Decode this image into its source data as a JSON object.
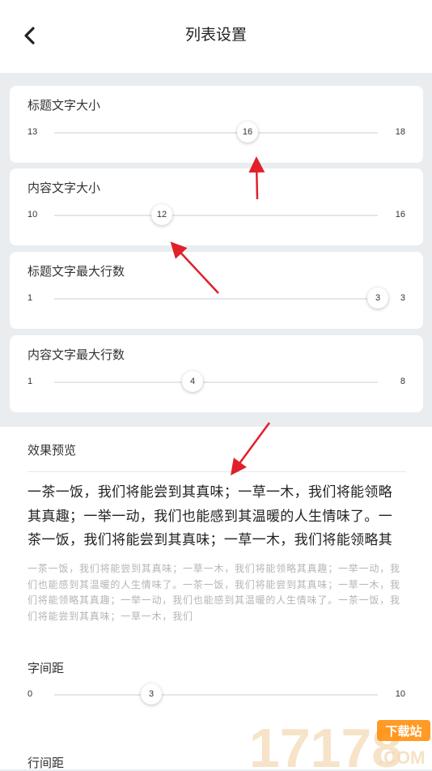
{
  "header": {
    "title": "列表设置"
  },
  "cards": [
    {
      "label": "标题文字大小",
      "min": "13",
      "max": "18",
      "value": "16",
      "ratio": 0.6
    },
    {
      "label": "内容文字大小",
      "min": "10",
      "max": "16",
      "value": "12",
      "ratio": 0.333
    },
    {
      "label": "标题文字最大行数",
      "min": "1",
      "max": "3",
      "value": "3",
      "ratio": 1.0
    },
    {
      "label": "内容文字最大行数",
      "min": "1",
      "max": "8",
      "value": "4",
      "ratio": 0.428
    }
  ],
  "preview": {
    "title": "效果预览",
    "main_text": "一茶一饭，我们将能尝到其真味；一草一木，我们将能领略其真趣；一举一动，我们也能感到其温暖的人生情味了。一茶一饭，我们将能尝到其真味；一草一木，我们将能领略其",
    "sub_text": "一茶一饭，我们将能尝到其真味；一草一木，我们将能领略其真趣；一举一动，我们也能感到其温暖的人生情味了。一茶一饭，我们将能尝到其真味；一草一木，我们将能领略其真趣；一举一动，我们也能感到其温暖的人生情味了。一茶一饭，我们将能尝到其真味；一草一木，我们"
  },
  "letter_spacing": {
    "label": "字间距",
    "min": "0",
    "max": "10",
    "value": "3",
    "ratio": 0.3
  },
  "line_spacing": {
    "label": "行间距"
  },
  "colors": {
    "arrow": "#e0202a",
    "thumb_bg": "#ffffff",
    "track": "#e6e6e6"
  },
  "watermark": {
    "digits": "17178",
    "badge": "下载站",
    "domain": ".COM"
  }
}
